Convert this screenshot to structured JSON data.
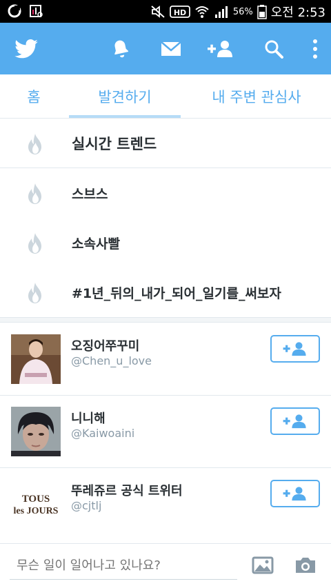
{
  "status_bar": {
    "battery": "56%",
    "clock": "오전 2:53"
  },
  "app_bar": {
    "icons": [
      "twitter-bird-icon",
      "notifications-icon",
      "messages-icon",
      "add-user-icon",
      "search-icon",
      "overflow-menu-icon"
    ]
  },
  "tabs": [
    {
      "label": "홈",
      "selected": false
    },
    {
      "label": "발견하기",
      "selected": true
    },
    {
      "label": "내 주변 관심사",
      "selected": false
    }
  ],
  "trends": {
    "header": "실시간 트렌드",
    "items": [
      "스브스",
      "소속사빨",
      "#1년_뒤의_내가_되어_일기를_써보자"
    ]
  },
  "who_to_follow": [
    {
      "name": "오징어쭈꾸미",
      "handle": "@Chen_u_love"
    },
    {
      "name": "니니해",
      "handle": "@Kaiwoaini"
    },
    {
      "name": "뚜레쥬르 공식 트위터",
      "handle": "@cjtlj",
      "avatar_logo": "TOUS les JOURS"
    }
  ],
  "composer": {
    "placeholder": "무슨 일이 일어나고 있나요?"
  },
  "colors": {
    "twitter_blue": "#55acee",
    "divider": "#e1e8ed",
    "flame_gray": "#ccd6dd"
  }
}
